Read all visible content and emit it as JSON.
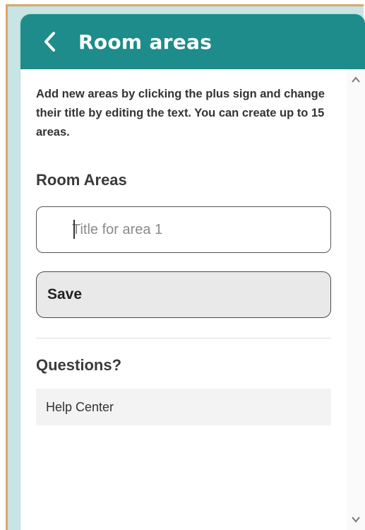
{
  "header": {
    "title": "Room areas",
    "back_icon": "chevron-left-icon"
  },
  "intro_text": "Add new areas by clicking the plus sign and change their title by editing the text. You can create up to 15 areas.",
  "room_areas": {
    "heading": "Room Areas",
    "area_1_placeholder": "Title for area 1",
    "area_1_value": ""
  },
  "save_label": "Save",
  "questions": {
    "heading": "Questions?",
    "help_link": "Help Center"
  },
  "colors": {
    "header_bg": "#1e8c8a",
    "frame_accent": "#d9a869",
    "background": "#c9e4e4"
  }
}
